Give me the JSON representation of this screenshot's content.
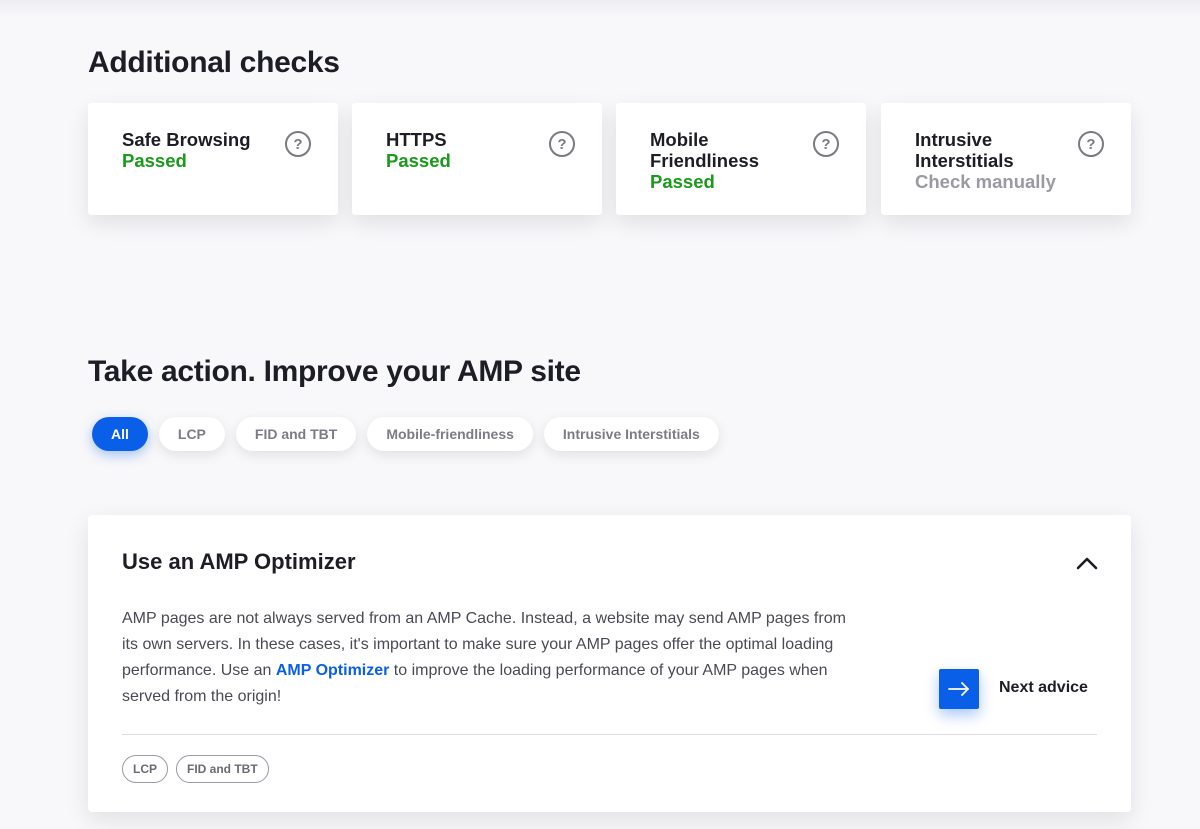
{
  "additional_checks": {
    "title": "Additional checks",
    "items": [
      {
        "name": "Safe Browsing",
        "status": "Passed",
        "status_kind": "pass"
      },
      {
        "name": "HTTPS",
        "status": "Passed",
        "status_kind": "pass"
      },
      {
        "name": "Mobile Friendliness",
        "status": "Passed",
        "status_kind": "pass"
      },
      {
        "name": "Intrusive Interstitials",
        "status": "Check manually",
        "status_kind": "manual"
      }
    ],
    "help_icon_glyph": "?"
  },
  "take_action": {
    "title": "Take action. Improve your AMP site",
    "filters": [
      "All",
      "LCP",
      "FID and TBT",
      "Mobile-friendliness",
      "Intrusive Interstitials"
    ],
    "active_filter": "All"
  },
  "advice": {
    "title": "Use an AMP Optimizer",
    "body_before_link": "AMP pages are not always served from an AMP Cache. Instead, a website may send AMP pages from its own servers. In these cases, it's important to make sure your AMP pages offer the optimal loading performance. Use an ",
    "link_text": "AMP Optimizer",
    "body_after_link": " to improve the loading performance of your AMP pages when served from the origin!",
    "next_label": "Next advice",
    "tags": [
      "LCP",
      "FID and TBT"
    ]
  },
  "colors": {
    "accent": "#0a5fe8",
    "pass": "#1a9a1a",
    "manual": "#9a9aa4"
  },
  "icons": {
    "help": "question-circle-icon",
    "collapse": "chevron-up-icon",
    "next": "arrow-right-icon"
  }
}
